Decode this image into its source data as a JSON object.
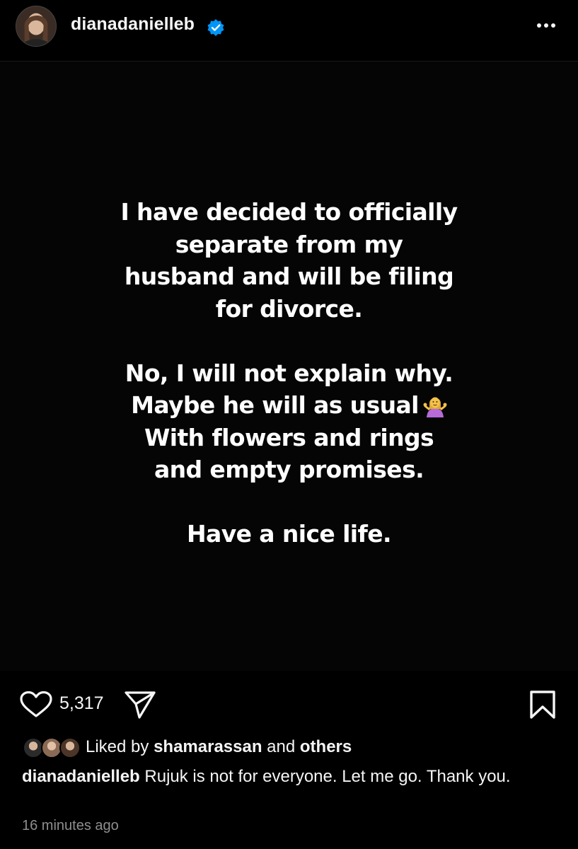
{
  "header": {
    "username": "dianadanielleb",
    "verified_icon": "verified-badge-icon",
    "more_icon": "more-options-icon",
    "accent_color": "#0095f6"
  },
  "post": {
    "lines": [
      "I have decided to officially",
      "separate from my",
      "husband and will be filing",
      "for divorce.",
      "",
      "No, I will not explain why.",
      "Maybe he will as usual",
      "With flowers and rings",
      "and empty promises.",
      "",
      "Have a nice life."
    ],
    "emoji": "person-shrugging-emoji"
  },
  "actions": {
    "like_icon": "heart-icon",
    "like_count": "5,317",
    "share_icon": "send-icon",
    "save_icon": "bookmark-icon"
  },
  "likes": {
    "prefix": "Liked by ",
    "user": "shamarassan",
    "middle": " and ",
    "others": "others"
  },
  "caption": {
    "username": "dianadanielleb",
    "text": "Rujuk is not for everyone. Let me go. Thank you."
  },
  "timestamp": "16 minutes ago"
}
